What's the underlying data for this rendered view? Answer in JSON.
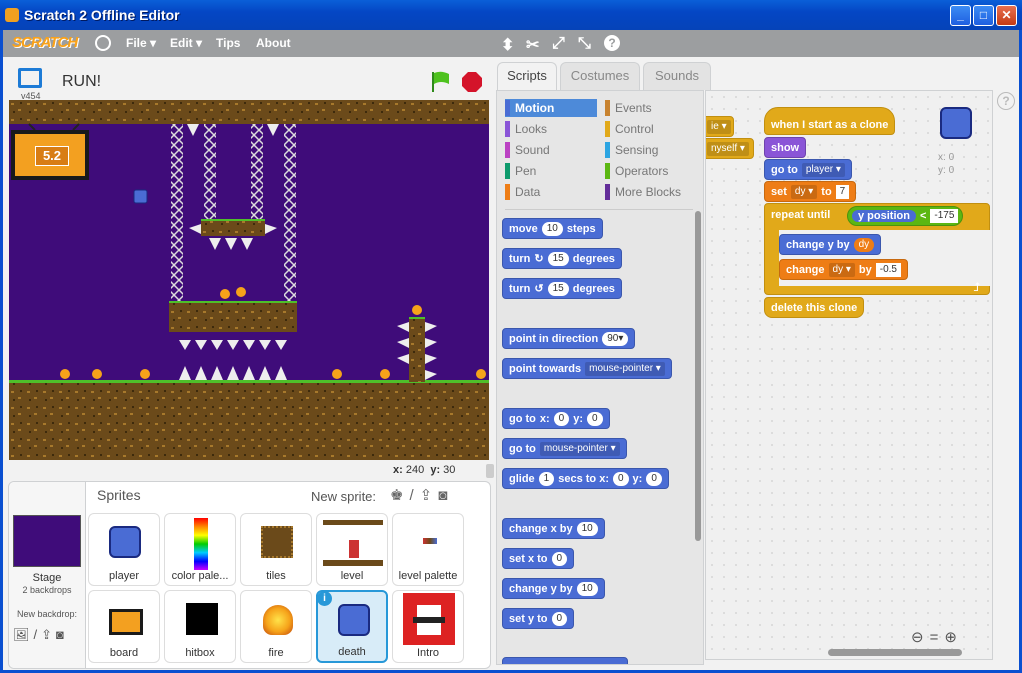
{
  "window": {
    "title": "Scratch 2 Offline Editor"
  },
  "menu": {
    "logo": "SCRATCH",
    "file": "File ▾",
    "edit": "Edit ▾",
    "tips": "Tips",
    "about": "About"
  },
  "stage": {
    "version": "v454",
    "project_title": "RUN!",
    "timer": "5.2",
    "x_label": "x:",
    "x": "240",
    "y_label": "y:",
    "y": "30"
  },
  "sprites_panel": {
    "title": "Sprites",
    "new_sprite": "New sprite:",
    "stage_label": "Stage",
    "backdrops": "2 backdrops",
    "new_backdrop": "New backdrop:",
    "items": [
      {
        "name": "player"
      },
      {
        "name": "color pale..."
      },
      {
        "name": "tiles"
      },
      {
        "name": "level"
      },
      {
        "name": "level palette"
      },
      {
        "name": "board"
      },
      {
        "name": "hitbox"
      },
      {
        "name": "fire"
      },
      {
        "name": "death"
      },
      {
        "name": "Intro"
      }
    ]
  },
  "tabs": {
    "scripts": "Scripts",
    "costumes": "Costumes",
    "sounds": "Sounds"
  },
  "categories": [
    {
      "label": "Motion",
      "color": "#4a6cd4"
    },
    {
      "label": "Looks",
      "color": "#8a55d7"
    },
    {
      "label": "Sound",
      "color": "#bb42c3"
    },
    {
      "label": "Pen",
      "color": "#0e9a6c"
    },
    {
      "label": "Data",
      "color": "#ee7d16"
    },
    {
      "label": "Events",
      "color": "#c88330"
    },
    {
      "label": "Control",
      "color": "#e1a91a"
    },
    {
      "label": "Sensing",
      "color": "#2ca5e2"
    },
    {
      "label": "Operators",
      "color": "#5cb712"
    },
    {
      "label": "More Blocks",
      "color": "#632d99"
    }
  ],
  "palette": {
    "move": "move",
    "steps": "steps",
    "move_val": "10",
    "turn": "turn",
    "degrees": "degrees",
    "turn_val": "15",
    "point_dir": "point in direction",
    "dir_val": "90▾",
    "point_towards": "point towards",
    "mouse_pointer": "mouse-pointer",
    "go_to": "go to",
    "x": "x:",
    "y": "y:",
    "zero": "0",
    "glide": "glide",
    "secs_to_x": "secs to x:",
    "glide_val": "1",
    "change_x": "change x by",
    "set_x": "set x to",
    "change_y": "change y by",
    "set_y": "set y to",
    "ten": "10"
  },
  "script": {
    "partial1": "ie",
    "partial2": "nyself",
    "hat": "when I start as a clone",
    "show": "show",
    "go_to": "go to",
    "player": "player",
    "set": "set",
    "dy": "dy",
    "to": "to",
    "seven": "7",
    "repeat_until": "repeat until",
    "y_position": "y position",
    "lt": "<",
    "neg175": "-175",
    "change_y_by": "change y by",
    "change": "change",
    "by": "by",
    "neg05": "-0.5",
    "delete": "delete this clone",
    "sprite_x_label": "x:",
    "sprite_x": "0",
    "sprite_y_label": "y:",
    "sprite_y": "0"
  },
  "colors": {
    "stage_bg": "#3f0c7a",
    "accent": "#2798d8"
  }
}
